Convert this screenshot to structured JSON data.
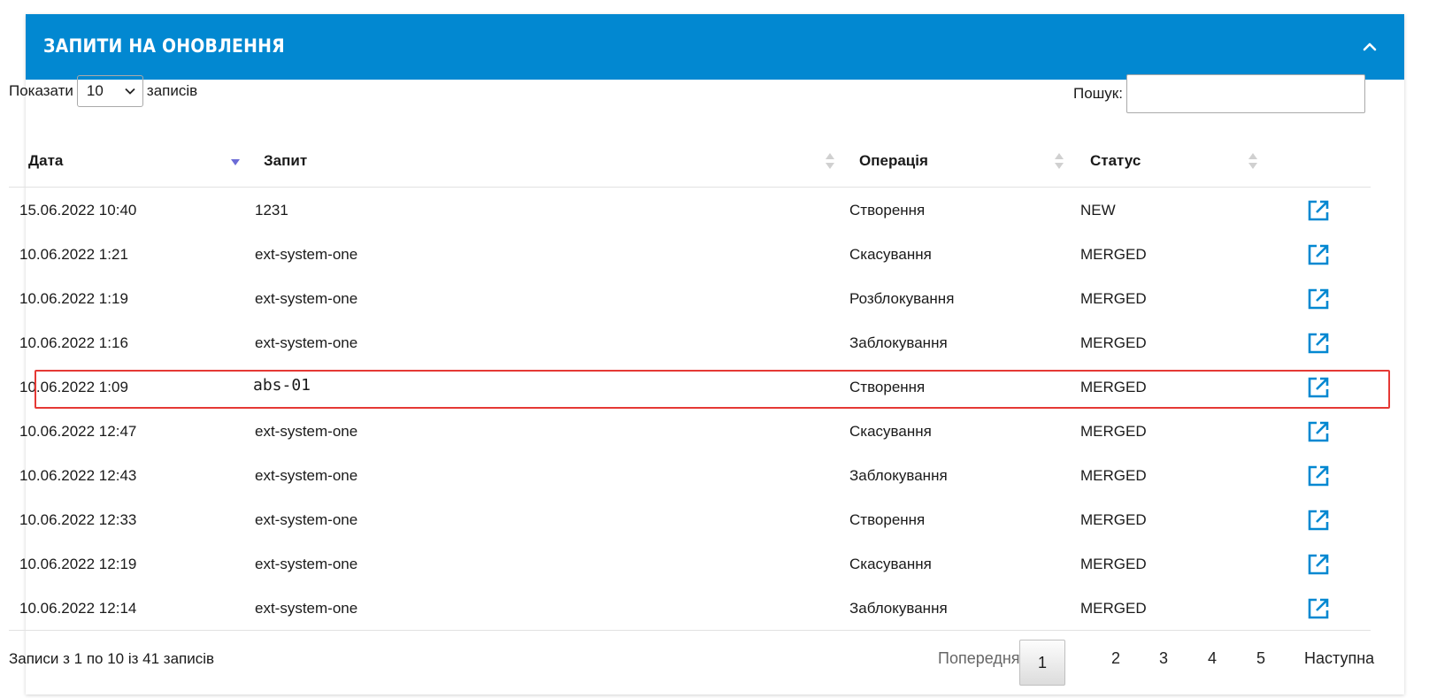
{
  "panel": {
    "title": "ЗАПИТИ НА ОНОВЛЕННЯ"
  },
  "controls": {
    "show_label": "Показати",
    "page_size": "10",
    "records_label": "записів",
    "search_label": "Пошук:",
    "search_value": ""
  },
  "columns": [
    "Дата",
    "Запит",
    "Операція",
    "Статус"
  ],
  "rows": [
    {
      "date": "15.06.2022 10:40",
      "request": "1231",
      "operation": "Створення",
      "status": "NEW"
    },
    {
      "date": "10.06.2022 1:21",
      "request": "ext-system-one",
      "operation": "Скасування",
      "status": "MERGED"
    },
    {
      "date": "10.06.2022 1:19",
      "request": "ext-system-one",
      "operation": "Розблокування",
      "status": "MERGED"
    },
    {
      "date": "10.06.2022 1:16",
      "request": "ext-system-one",
      "operation": "Заблокування",
      "status": "MERGED"
    },
    {
      "date": "10.06.2022 1:09",
      "request": "abs-01",
      "operation": "Створення",
      "status": "MERGED"
    },
    {
      "date": "10.06.2022 12:47",
      "request": "ext-system-one",
      "operation": "Скасування",
      "status": "MERGED"
    },
    {
      "date": "10.06.2022 12:43",
      "request": "ext-system-one",
      "operation": "Заблокування",
      "status": "MERGED"
    },
    {
      "date": "10.06.2022 12:33",
      "request": "ext-system-one",
      "operation": "Створення",
      "status": "MERGED"
    },
    {
      "date": "10.06.2022 12:19",
      "request": "ext-system-one",
      "operation": "Скасування",
      "status": "MERGED"
    },
    {
      "date": "10.06.2022 12:14",
      "request": "ext-system-one",
      "operation": "Заблокування",
      "status": "MERGED"
    }
  ],
  "footer": {
    "info": "Записи з 1 по 10 із 41 записів",
    "prev": "Попередня",
    "next": "Наступна",
    "pages": [
      "1",
      "2",
      "3",
      "4",
      "5"
    ],
    "current_page": "1"
  },
  "colors": {
    "header_bg": "#0288d1",
    "link_icon": "#0288d1",
    "highlight": "#e53935",
    "sort_active": "#6b6bd6",
    "sort_inactive": "#d0d0d0"
  },
  "icons": {
    "collapse": "chevron-up-icon",
    "row_action": "external-link-icon",
    "sort_active": "sort-desc-icon",
    "sort": "sort-both-icon",
    "select": "chevron-down-icon"
  }
}
